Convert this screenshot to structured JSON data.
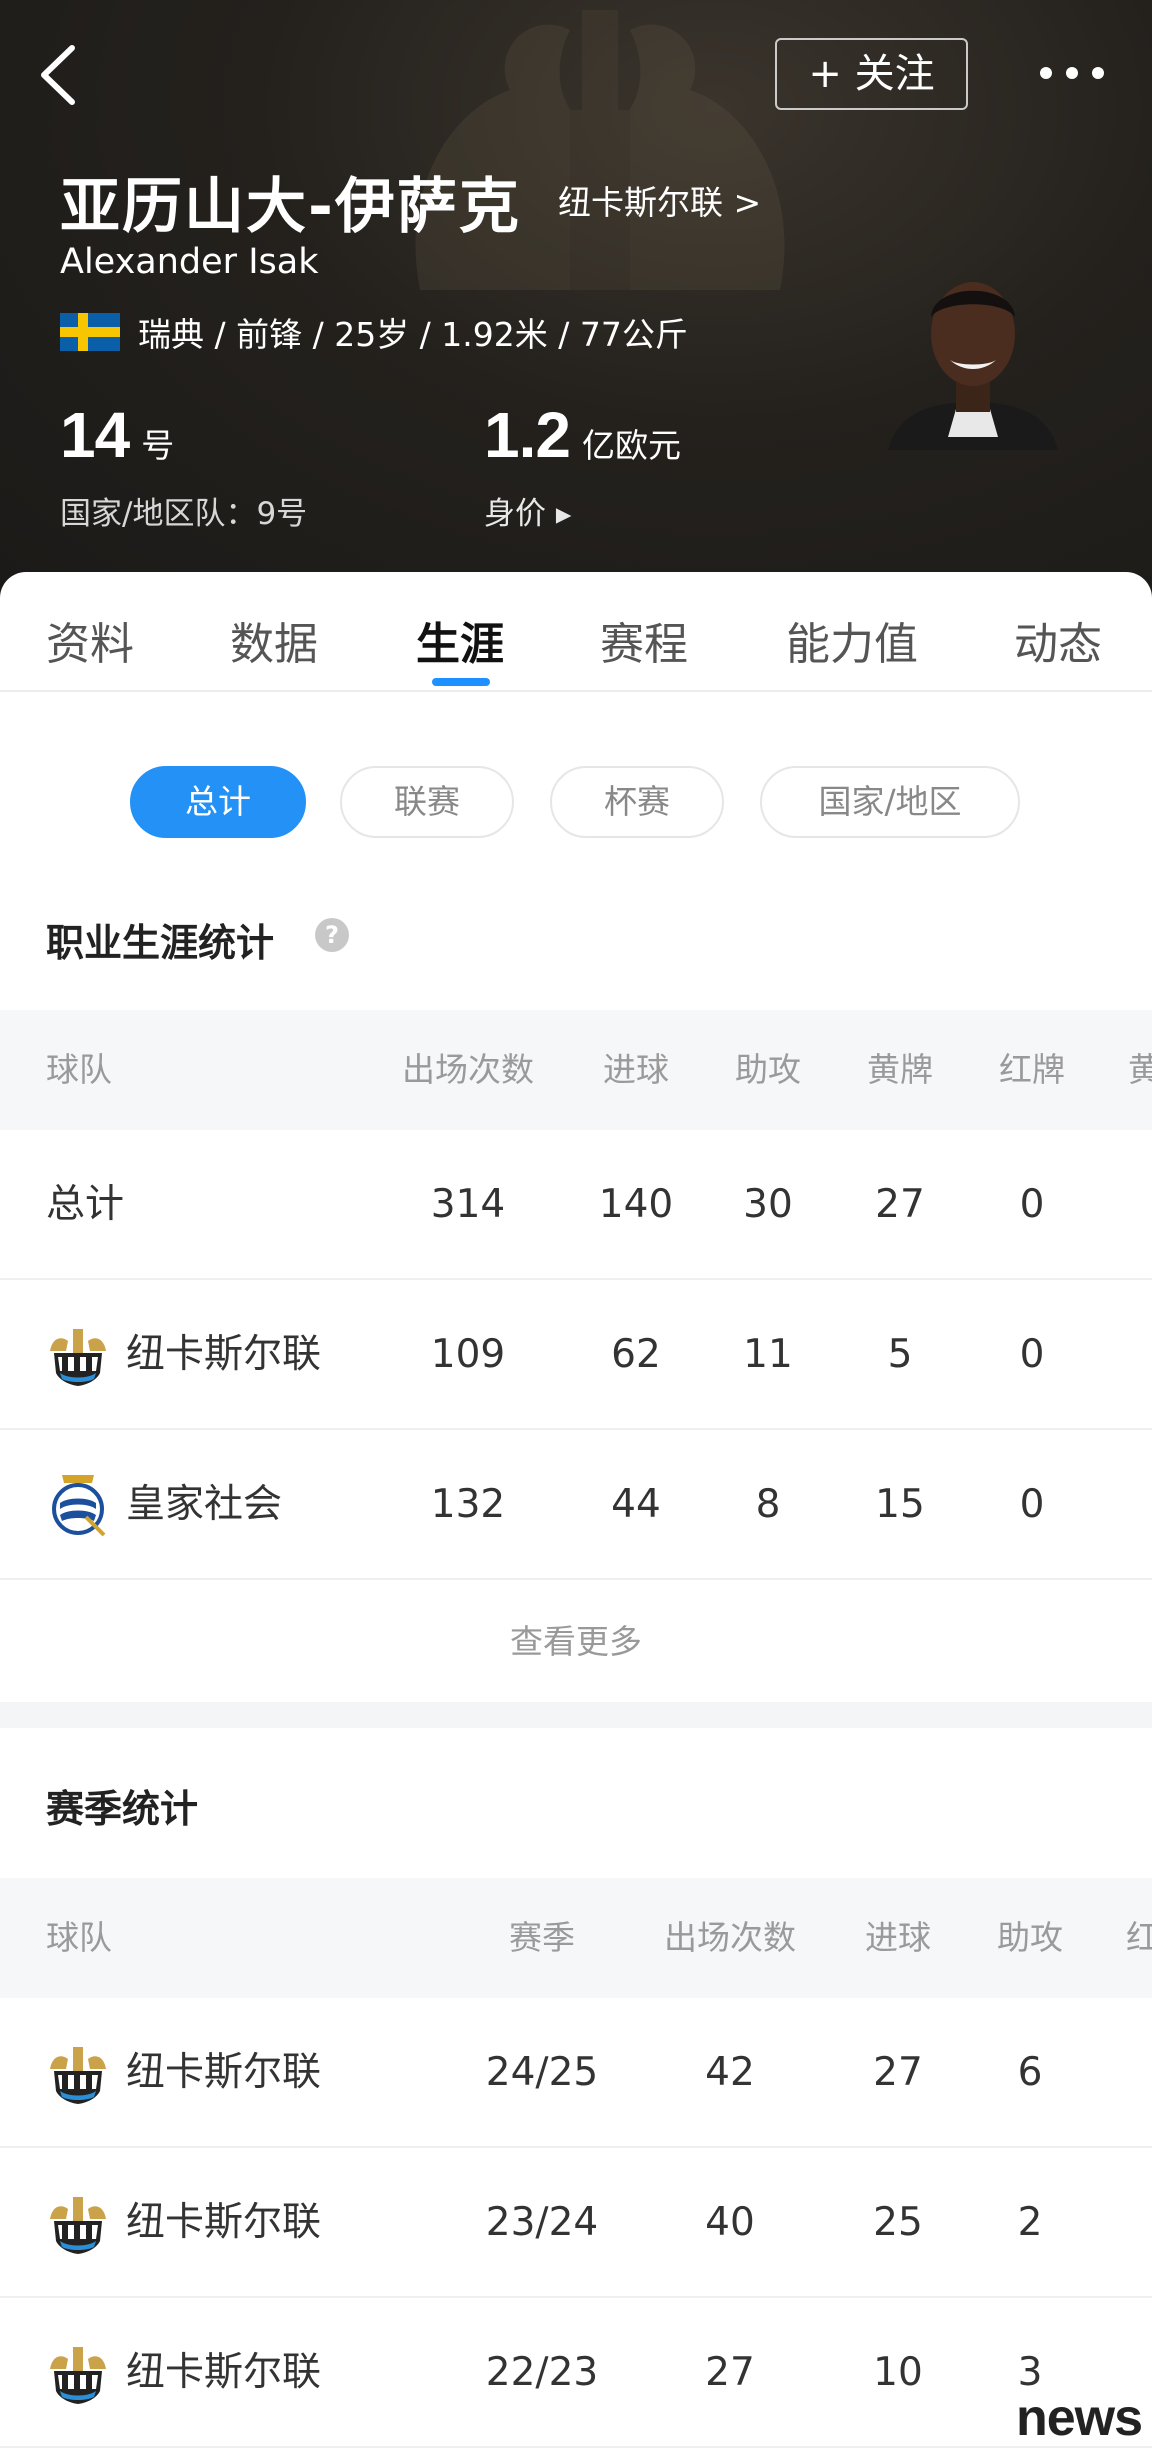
{
  "header": {
    "back_icon": "chevron-left-icon",
    "follow_label": "+ 关注",
    "more_icon": "more-dots-icon",
    "name_cn": "亚历山大-伊萨克",
    "club_link": "纽卡斯尔联 >",
    "name_en": "Alexander Isak",
    "flag_icon": "sweden-flag-icon",
    "info": "瑞典 / 前锋 / 25岁 / 1.92米 / 77公斤",
    "number": "14",
    "number_unit": "号",
    "national_team": "国家/地区队：9号",
    "value": "1.2",
    "value_unit": "亿欧元",
    "value_label": "身价 ▸"
  },
  "tabs": [
    {
      "label": "资料"
    },
    {
      "label": "数据"
    },
    {
      "label": "生涯",
      "active": true
    },
    {
      "label": "赛程"
    },
    {
      "label": "能力值"
    },
    {
      "label": "动态"
    }
  ],
  "filters": [
    {
      "label": "总计",
      "active": true
    },
    {
      "label": "联赛"
    },
    {
      "label": "杯赛"
    },
    {
      "label": "国家/地区"
    }
  ],
  "career": {
    "title": "职业生涯统计",
    "help_icon": "question-circle-icon",
    "headers": [
      "球队",
      "出场次数",
      "进球",
      "助攻",
      "黄牌",
      "红牌",
      "黄"
    ],
    "rows": [
      {
        "team": "总计",
        "apps": "314",
        "goals": "140",
        "assists": "30",
        "yellow": "27",
        "red": "0"
      },
      {
        "team": "纽卡斯尔联",
        "logo": "newcastle-crest-icon",
        "apps": "109",
        "goals": "62",
        "assists": "11",
        "yellow": "5",
        "red": "0"
      },
      {
        "team": "皇家社会",
        "logo": "real-sociedad-crest-icon",
        "apps": "132",
        "goals": "44",
        "assists": "8",
        "yellow": "15",
        "red": "0"
      }
    ],
    "more_label": "查看更多"
  },
  "season": {
    "title": "赛季统计",
    "headers": [
      "球队",
      "赛季",
      "出场次数",
      "进球",
      "助攻",
      "红"
    ],
    "rows": [
      {
        "team": "纽卡斯尔联",
        "season": "24/25",
        "apps": "42",
        "goals": "27",
        "assists": "6"
      },
      {
        "team": "纽卡斯尔联",
        "season": "23/24",
        "apps": "40",
        "goals": "25",
        "assists": "2"
      },
      {
        "team": "纽卡斯尔联",
        "season": "22/23",
        "apps": "27",
        "goals": "10",
        "assists": "3"
      }
    ]
  },
  "watermark": "news",
  "colors": {
    "accent": "#2391f5",
    "header_bg": "#211f1c"
  }
}
